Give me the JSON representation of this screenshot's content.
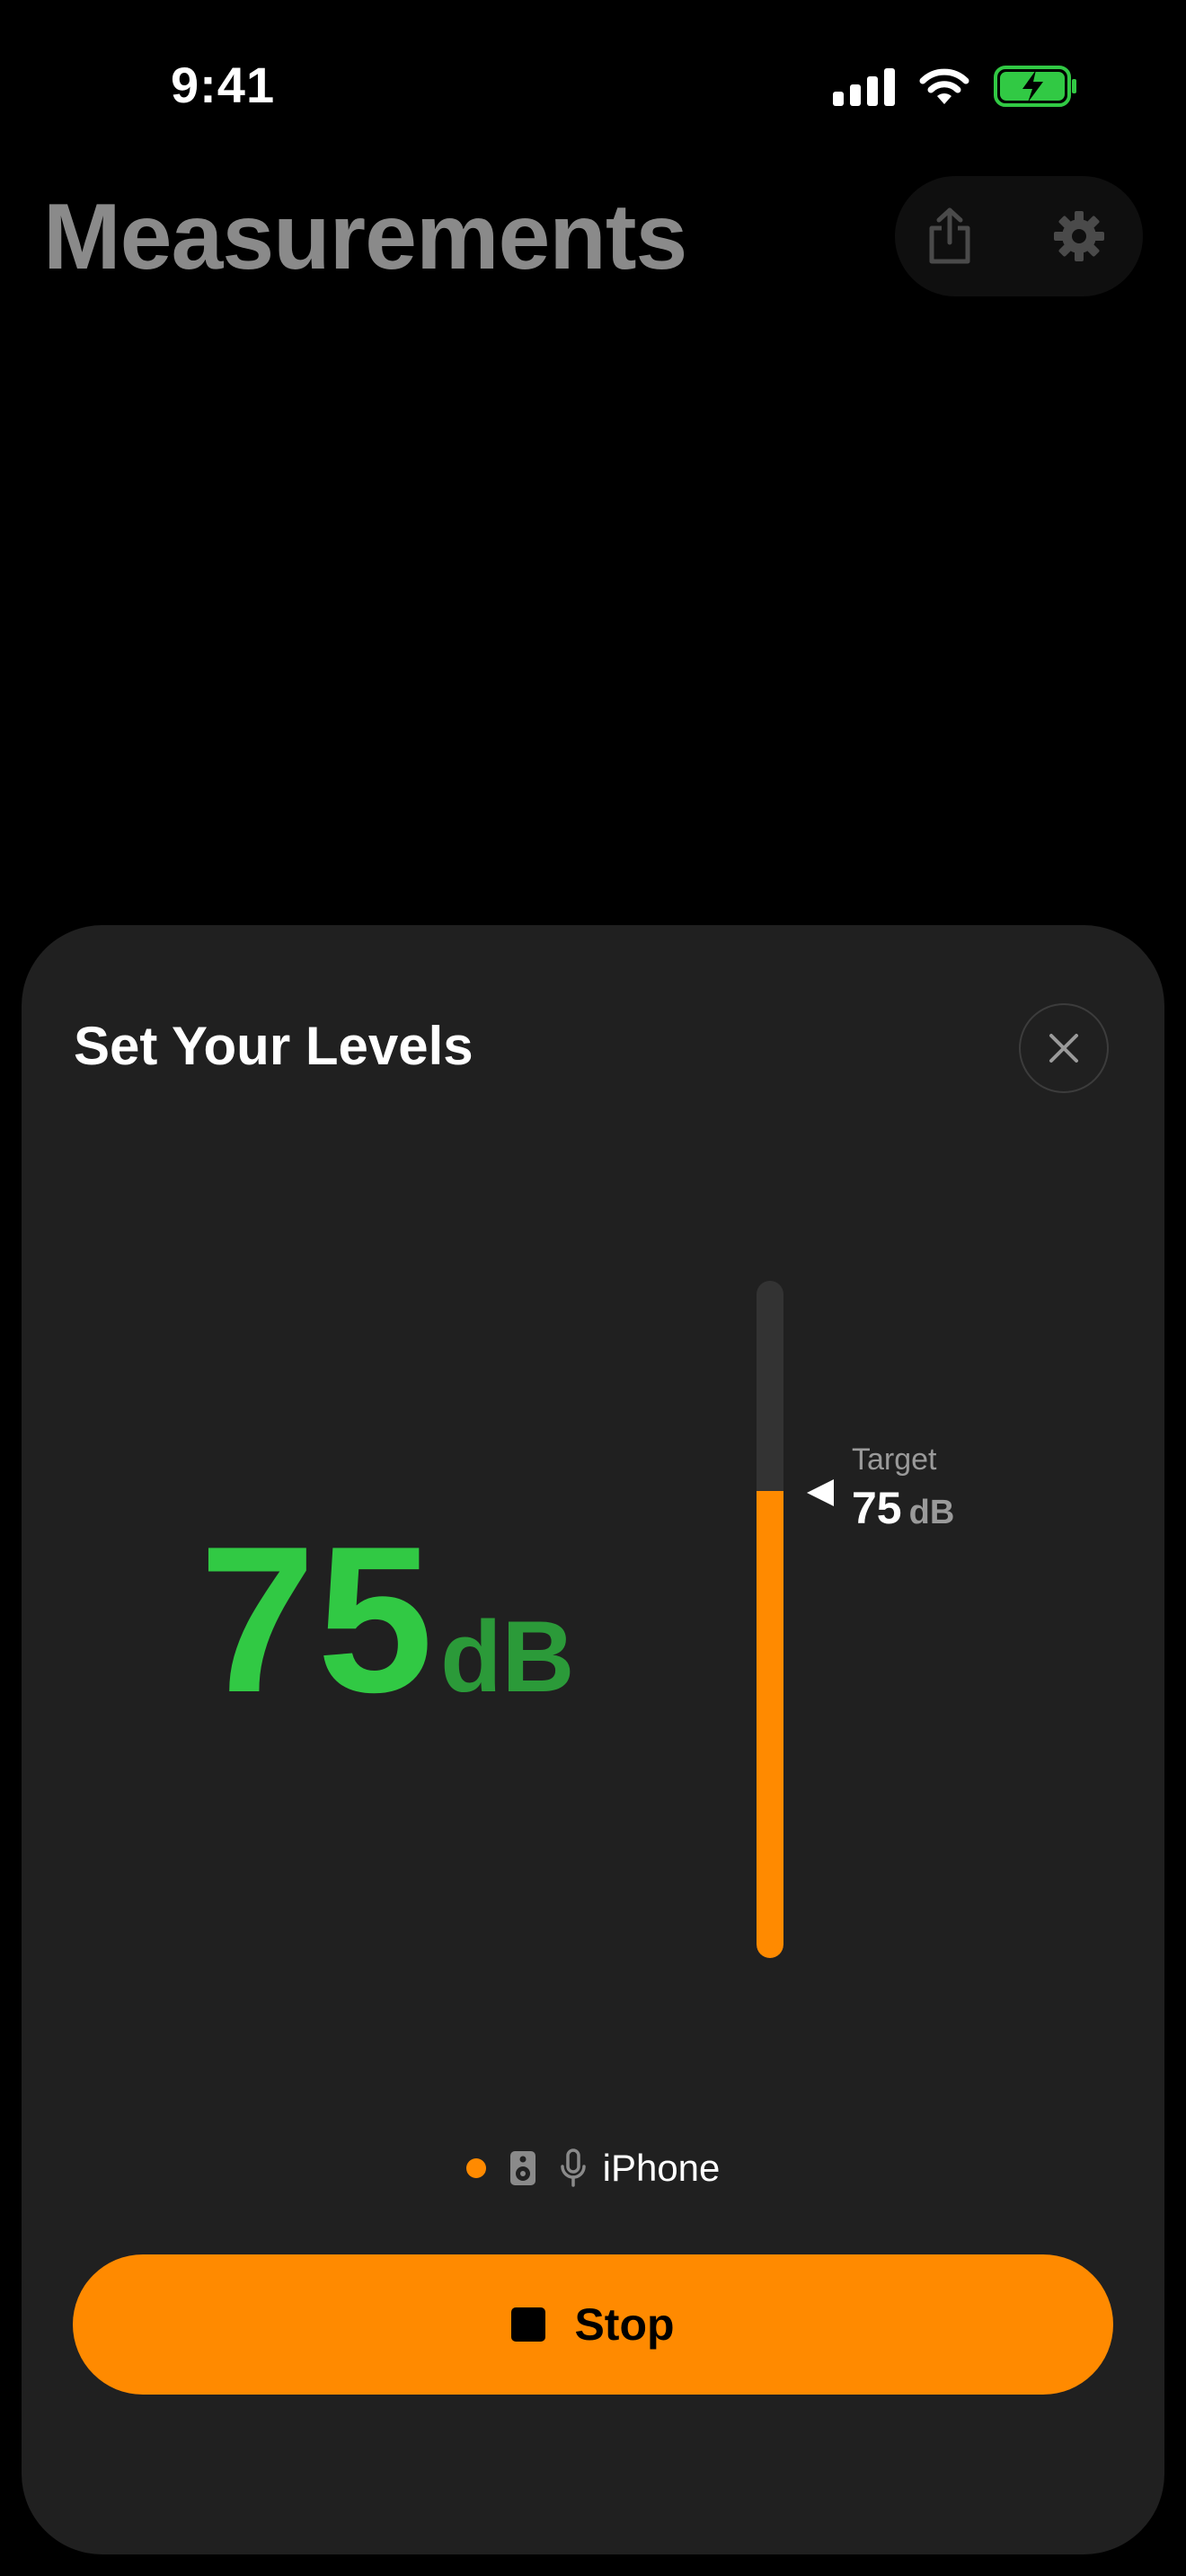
{
  "status_bar": {
    "time": "9:41"
  },
  "header": {
    "title": "Measurements",
    "share_icon": "share-icon",
    "settings_icon": "gear-icon"
  },
  "sheet": {
    "title": "Set Your Levels",
    "close_icon": "close-icon",
    "level": {
      "value": "75",
      "unit": "dB"
    },
    "meter": {
      "fill_fraction": 0.69,
      "target_fraction": 0.69
    },
    "target": {
      "label": "Target",
      "value": "75",
      "unit": "dB"
    },
    "device": {
      "indicator_icon": "status-dot-icon",
      "speaker_icon": "speaker-icon",
      "mic_icon": "microphone-icon",
      "name": "iPhone"
    },
    "stop_button": {
      "icon": "stop-icon",
      "label": "Stop"
    }
  },
  "colors": {
    "background": "#000000",
    "sheet": "#202020",
    "accent_orange": "#ff8a00",
    "level_green": "#31c944",
    "level_unit_green": "#2b9a39",
    "muted_text": "#9a9a9a",
    "title_gray": "#8a8a8a"
  }
}
